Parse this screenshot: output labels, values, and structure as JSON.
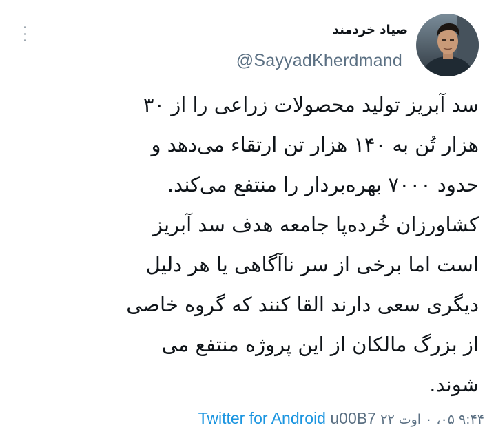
{
  "user": {
    "display_name": "صیاد خردمند",
    "handle": "@SayyadKherdmand"
  },
  "tweet": {
    "text": "سد آبریز تولید محصولات زراعی را  از ۳۰\nهزار تُن به ۱۴۰ هزار تن ارتقاء می‌دهد و\nحدود ۷۰۰۰ بهره‌بردار را منتفع می‌کند.\nکشاورزان خُرده‌پا جامعه هدف سد آبریز\nاست اما برخی از سر ناآگاهی یا هر دلیل\nدیگری سعی دارند القا کنند که گروه خاصی\nاز بزرگ مالکان از این پروژه منتفع می\nشوند."
  },
  "meta": {
    "timestamp": "۹:۴۴ ۰۵، ۰ اوت ۲۲",
    "separator": "u00B7",
    "source": "Twitter for Android"
  },
  "colors": {
    "text": "#0f1419",
    "secondary": "#5b7083",
    "link": "#1b95e0"
  },
  "icons": {
    "menu": "more-vertical-icon"
  }
}
